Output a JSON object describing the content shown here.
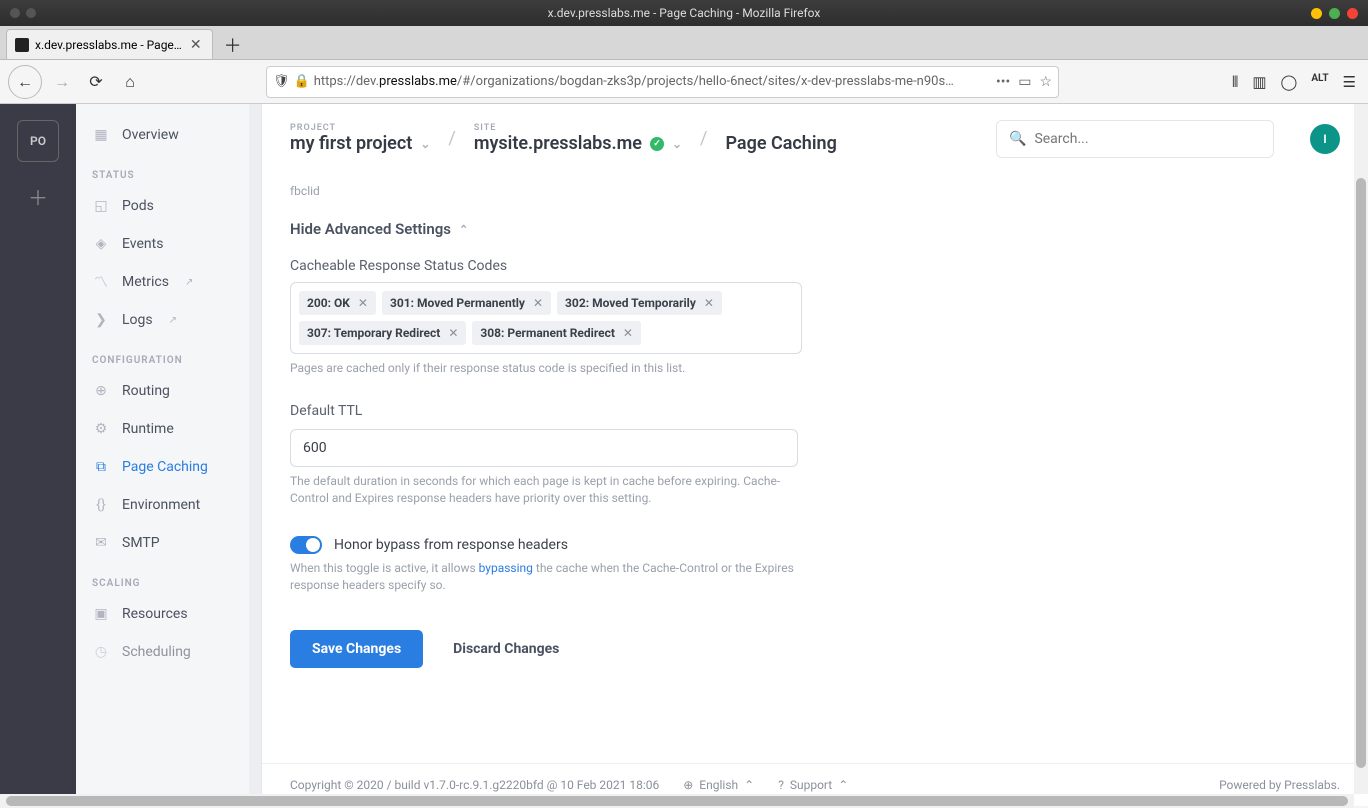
{
  "window": {
    "title": "x.dev.presslabs.me - Page Caching - Mozilla Firefox"
  },
  "tabs": {
    "active": "x.dev.presslabs.me - Page…"
  },
  "url": {
    "protocol": "https://",
    "sub": "dev.",
    "host": "presslabs.me",
    "path": "/#/organizations/bogdan-zks3p/projects/hello-6nect/sites/x-dev-presslabs-me-n90s…"
  },
  "header": {
    "projectLabel": "PROJECT",
    "projectName": "my first project",
    "siteLabel": "SITE",
    "siteName": "mysite.presslabs.me",
    "pageTitle": "Page Caching",
    "searchPlaceholder": "Search...",
    "orgInitials": "PO",
    "userInitial": "I"
  },
  "sidebar": {
    "overview": "Overview",
    "statusLabel": "STATUS",
    "pods": "Pods",
    "events": "Events",
    "metrics": "Metrics",
    "logs": "Logs",
    "configLabel": "CONFIGURATION",
    "routing": "Routing",
    "runtime": "Runtime",
    "pageCaching": "Page Caching",
    "environment": "Environment",
    "smtp": "SMTP",
    "scalingLabel": "SCALING",
    "resources": "Resources",
    "scheduling": "Scheduling"
  },
  "content": {
    "fbclid": "fbclid",
    "advToggle": "Hide Advanced Settings",
    "codesLabel": "Cacheable Response Status Codes",
    "codes": [
      "200: OK",
      "301: Moved Permanently",
      "302: Moved Temporarily",
      "307: Temporary Redirect",
      "308: Permanent Redirect"
    ],
    "codesHelp": "Pages are cached only if their response status code is specified in this list.",
    "ttlLabel": "Default TTL",
    "ttlValue": "600",
    "ttlHelp": "The default duration in seconds for which each page is kept in cache before expiring. Cache-Control and Expires response headers have priority over this setting.",
    "bypassLabel": "Honor bypass from response headers",
    "bypassHelp1": "When this toggle is active, it allows ",
    "bypassLink": "bypassing",
    "bypassHelp2": " the cache when the Cache-Control or the Expires response headers specify so.",
    "save": "Save Changes",
    "discard": "Discard Changes"
  },
  "footer": {
    "copyright": "Copyright © 2020 / build v1.7.0-rc.9.1.g2220bfd @ 10 Feb 2021 18:06",
    "language": "English",
    "support": "Support",
    "powered": "Powered by Presslabs."
  }
}
